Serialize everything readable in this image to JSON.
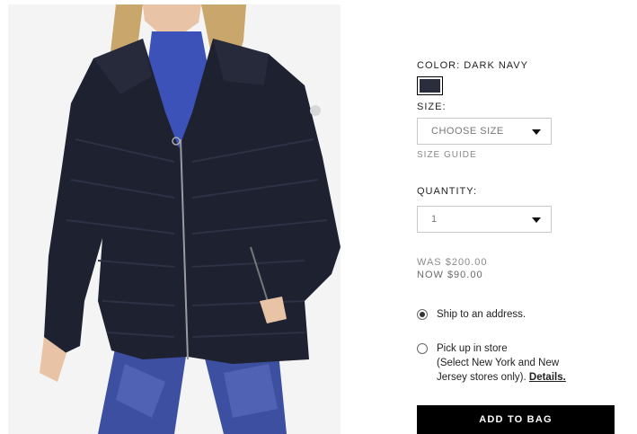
{
  "product": {
    "image_name": "product-photo",
    "color_label": "COLOR: DARK NAVY",
    "swatch_color": "#2a2d3c",
    "size_label": "SIZE:",
    "size_value": "CHOOSE SIZE",
    "size_guide": "SIZE GUIDE",
    "quantity_label": "QUANTITY:",
    "quantity_value": "1",
    "price_was": "WAS $200.00",
    "price_now": "NOW $90.00"
  },
  "shipping": {
    "ship_label": "Ship to an address.",
    "pickup_line1": "Pick up in store",
    "pickup_line2": "(Select New York and New",
    "pickup_line3_prefix": "Jersey stores only).",
    "details_link": "Details."
  },
  "actions": {
    "add_to_bag": "ADD TO BAG"
  },
  "colors": {
    "jacket": "#1e2130",
    "accent": "#000000",
    "leggings": "#3d4fa0"
  },
  "icons": [
    "chevron-down-icon"
  ]
}
